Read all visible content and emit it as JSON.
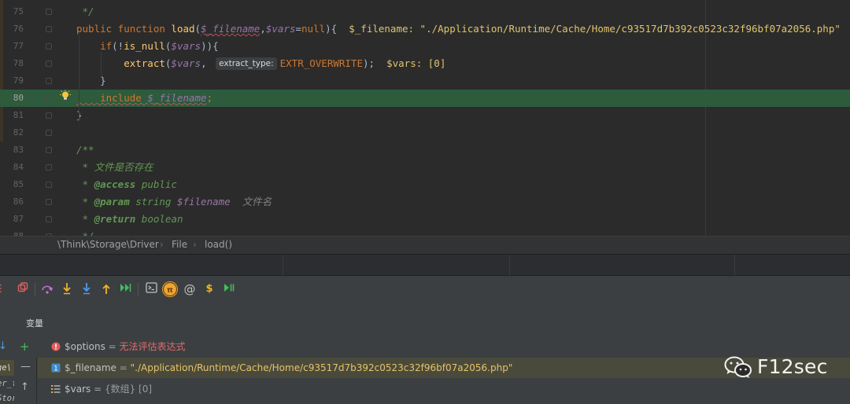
{
  "editor": {
    "lines": [
      {
        "num": "75",
        "segments": [
          {
            "t": " */",
            "c": "doc"
          }
        ]
      },
      {
        "num": "76",
        "segments": [
          {
            "t": "public function ",
            "c": "kw"
          },
          {
            "t": "load",
            "c": "fn"
          },
          {
            "t": "(",
            "c": "plain"
          },
          {
            "t": "$_filename",
            "c": "var wavy"
          },
          {
            "t": ",",
            "c": "plain"
          },
          {
            "t": "$vars",
            "c": "var"
          },
          {
            "t": "=",
            "c": "plain"
          },
          {
            "t": "null",
            "c": "kw"
          },
          {
            "t": "){",
            "c": "plain"
          },
          {
            "t": "  $_filename: \"./Application/Runtime/Cache/Home/c93517d7b392c0523c32f96bf07a2056.php\"  $vars: [0]",
            "c": "inline-val"
          }
        ]
      },
      {
        "num": "77",
        "segments": [
          {
            "t": "    if",
            "c": "kw"
          },
          {
            "t": "(!",
            "c": "plain"
          },
          {
            "t": "is_null",
            "c": "fn"
          },
          {
            "t": "(",
            "c": "plain"
          },
          {
            "t": "$vars",
            "c": "var"
          },
          {
            "t": ")){",
            "c": "plain"
          }
        ]
      },
      {
        "num": "78",
        "segments": [
          {
            "t": "        extract",
            "c": "fn"
          },
          {
            "t": "(",
            "c": "plain"
          },
          {
            "t": "$vars",
            "c": "var"
          },
          {
            "t": ", ",
            "c": "plain"
          },
          {
            "t": "extract_type:",
            "c": "hint"
          },
          {
            "t": "EXTR_OVERWRITE",
            "c": "kw"
          },
          {
            "t": ");  ",
            "c": "plain"
          },
          {
            "t": "$vars: [0]",
            "c": "inline-val"
          }
        ]
      },
      {
        "num": "79",
        "segments": [
          {
            "t": "    }",
            "c": "plain"
          }
        ]
      },
      {
        "num": "80",
        "exec": true,
        "segments": [
          {
            "t": "    include ",
            "c": "kw wavy"
          },
          {
            "t": "$_filename",
            "c": "var wavy"
          },
          {
            "t": ";",
            "c": "kw"
          }
        ]
      },
      {
        "num": "81",
        "segments": [
          {
            "t": "}",
            "c": "plain"
          }
        ]
      },
      {
        "num": "82",
        "segments": []
      },
      {
        "num": "83",
        "segments": [
          {
            "t": "/**",
            "c": "doc"
          }
        ]
      },
      {
        "num": "84",
        "segments": [
          {
            "t": " * 文件是否存在",
            "c": "doc"
          }
        ]
      },
      {
        "num": "85",
        "segments": [
          {
            "t": " * ",
            "c": "doc"
          },
          {
            "t": "@access",
            "c": "doctag"
          },
          {
            "t": " public",
            "c": "doc"
          }
        ]
      },
      {
        "num": "86",
        "segments": [
          {
            "t": " * ",
            "c": "doc"
          },
          {
            "t": "@param",
            "c": "doctag"
          },
          {
            "t": " string ",
            "c": "doc"
          },
          {
            "t": "$filename",
            "c": "var"
          },
          {
            "t": "  文件名",
            "c": "comment"
          }
        ]
      },
      {
        "num": "87",
        "segments": [
          {
            "t": " * ",
            "c": "doc"
          },
          {
            "t": "@return",
            "c": "doctag"
          },
          {
            "t": " boolean",
            "c": "doc"
          }
        ]
      },
      {
        "num": "88",
        "segments": [
          {
            "t": " */",
            "c": "doc"
          }
        ]
      }
    ]
  },
  "breadcrumb": {
    "items": [
      "\\Think\\Storage\\Driver",
      "File",
      "load()"
    ]
  },
  "debug": {
    "variables_title": "变量",
    "frames_snippets": [
      "ge\\",
      "er_fu",
      "Stora"
    ],
    "variables": [
      {
        "name": "$options",
        "eq": " = ",
        "value": "无法评估表达式",
        "kind": "error"
      },
      {
        "name": "$_filename",
        "eq": " = ",
        "value": "\"./Application/Runtime/Cache/Home/c93517d7b392c0523c32f96bf07a2056.php\"",
        "kind": "string"
      },
      {
        "name": "$vars",
        "eq": " = ",
        "value": "{数组} [0]",
        "kind": "array"
      }
    ]
  },
  "watermark": {
    "text": "F12sec"
  },
  "colors": {
    "editor_bg": "#2b2b2b",
    "exec_line": "#2d5b3c",
    "panel_bg": "#3c3f41",
    "keyword": "#cc7832",
    "function": "#ffc66d",
    "variable": "#9876aa",
    "doc": "#629755",
    "error": "#e06c6c",
    "string_value": "#e6c36a"
  }
}
